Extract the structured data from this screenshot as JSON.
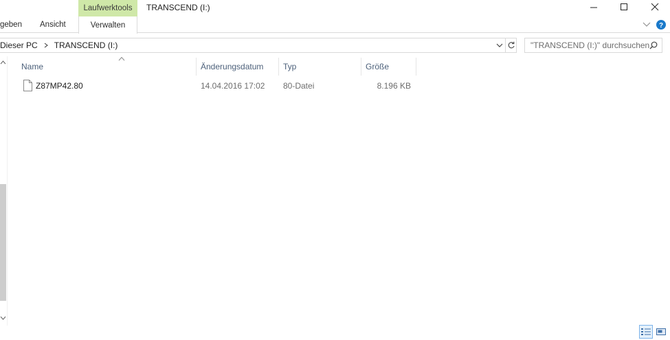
{
  "window": {
    "title": "TRANSCEND (I:)",
    "context_tab": "Laufwerktools"
  },
  "ribbon": {
    "tabs": [
      "geben",
      "Ansicht",
      "Verwalten"
    ],
    "active_tab": "Verwalten"
  },
  "address": {
    "crumbs": [
      "Dieser PC",
      "TRANSCEND (I:)"
    ]
  },
  "search": {
    "placeholder": "\"TRANSCEND (I:)\" durchsuchen"
  },
  "columns": {
    "name": "Name",
    "modified": "Änderungsdatum",
    "type": "Typ",
    "size": "Größe"
  },
  "files": [
    {
      "name": "Z87MP42.80",
      "modified": "14.04.2016 17:02",
      "type": "80-Datei",
      "size": "8.196 KB"
    }
  ],
  "colors": {
    "context_tab_bg": "#cfe8a8",
    "header_text": "#4c607a",
    "help_icon": "#1979ca",
    "active_view_border": "#7eb4ea"
  }
}
